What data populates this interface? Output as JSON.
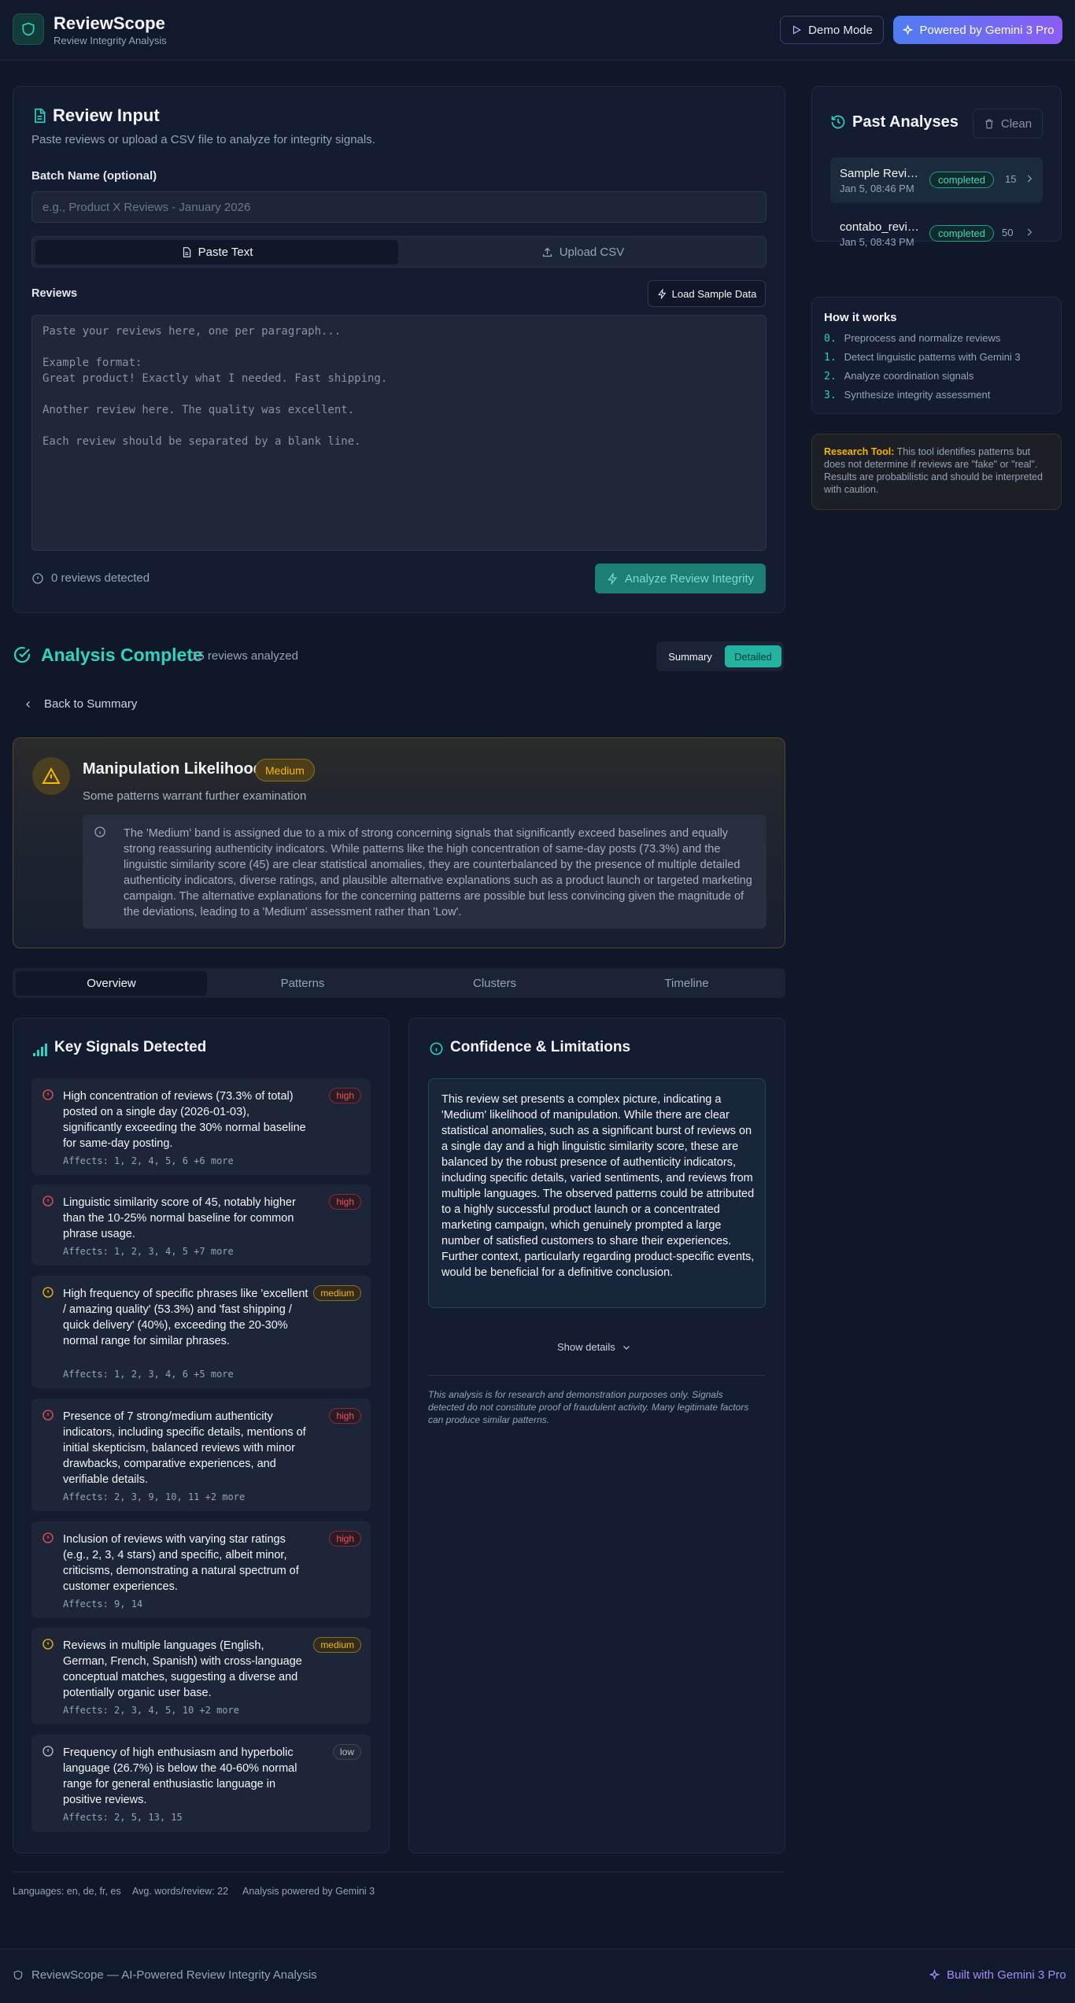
{
  "header": {
    "brand_title": "ReviewScope",
    "brand_subtitle": "Review Integrity Analysis",
    "demo_label": "Demo Mode",
    "gemini_label": "Powered by Gemini 3 Pro"
  },
  "review_input": {
    "title": "Review Input",
    "subtitle": "Paste reviews or upload a CSV file to analyze for integrity signals.",
    "batch_label": "Batch Name (optional)",
    "batch_placeholder": "e.g., Product X Reviews - January 2026",
    "tab_paste": "Paste Text",
    "tab_csv": "Upload CSV",
    "reviews_label": "Reviews",
    "sample_label": "Load Sample Data",
    "reviews_placeholder": "Paste your reviews here, one per paragraph...\n\nExample format:\nGreat product! Exactly what I needed. Fast shipping.\n\nAnother review here. The quality was excellent.\n\nEach review should be separated by a blank line.",
    "detected_text": "0 reviews detected",
    "analyze_label": "Analyze Review Integrity"
  },
  "past_analyses": {
    "title": "Past Analyses",
    "clean_label": "Clean",
    "items": [
      {
        "name": "Sample Reviews",
        "date": "Jan 5, 08:46 PM",
        "status": "completed",
        "count": "15"
      },
      {
        "name": "contabo_reviews",
        "date": "Jan 5, 08:43 PM",
        "status": "completed",
        "count": "50"
      }
    ]
  },
  "how_it_works": {
    "title": "How it works",
    "steps": [
      {
        "n": "0.",
        "text": "Preprocess and normalize reviews"
      },
      {
        "n": "1.",
        "text": "Detect linguistic patterns with Gemini 3"
      },
      {
        "n": "2.",
        "text": "Analyze coordination signals"
      },
      {
        "n": "3.",
        "text": "Synthesize integrity assessment"
      }
    ]
  },
  "research": {
    "label": "Research Tool:",
    "text": " This tool identifies patterns but does not determine if reviews are \"fake\" or \"real\". Results are probabilistic and should be interpreted with caution."
  },
  "analysis": {
    "title": "Analysis Complete",
    "subtitle": "15 reviews analyzed",
    "summary_label": "Summary",
    "detailed_label": "Detailed",
    "back_label": "Back to Summary"
  },
  "manipulation": {
    "title": "Manipulation Likelihood",
    "badge": "Medium",
    "subtitle": "Some patterns warrant further examination",
    "note": "The 'Medium' band is assigned due to a mix of strong concerning signals that significantly exceed baselines and equally strong reassuring authenticity indicators. While patterns like the high concentration of same-day posts (73.3%) and the linguistic similarity score (45) are clear statistical anomalies, they are counterbalanced by the presence of multiple detailed authenticity indicators, diverse ratings, and plausible alternative explanations such as a product launch or targeted marketing campaign. The alternative explanations for the concerning patterns are possible but less convincing given the magnitude of the deviations, leading to a 'Medium' assessment rather than 'Low'."
  },
  "tabs": [
    "Overview",
    "Patterns",
    "Clusters",
    "Timeline"
  ],
  "signals": {
    "title": "Key Signals Detected",
    "items": [
      {
        "text": "High concentration of reviews (73.3% of total) posted on a single day (2026-01-03), significantly exceeding the 30% normal baseline for same-day posting.",
        "affects": "Affects: 1, 2, 4, 5, 6 +6 more",
        "severity": "high"
      },
      {
        "text": "Linguistic similarity score of 45, notably higher than the 10-25% normal baseline for common phrase usage.",
        "affects": "Affects: 1, 2, 3, 4, 5 +7 more",
        "severity": "high"
      },
      {
        "text": "High frequency of specific phrases like 'excellent / amazing quality' (53.3%) and 'fast shipping / quick delivery' (40%), exceeding the 20-30% normal range for similar phrases.",
        "affects": "Affects: 1, 2, 3, 4, 6 +5 more",
        "severity": "medium"
      },
      {
        "text": "Presence of 7 strong/medium authenticity indicators, including specific details, mentions of initial skepticism, balanced reviews with minor drawbacks, comparative experiences, and verifiable details.",
        "affects": "Affects: 2, 3, 9, 10, 11 +2 more",
        "severity": "high"
      },
      {
        "text": "Inclusion of reviews with varying star ratings (e.g., 2, 3, 4 stars) and specific, albeit minor, criticisms, demonstrating a natural spectrum of customer experiences.",
        "affects": "Affects: 9, 14",
        "severity": "high"
      },
      {
        "text": "Reviews in multiple languages (English, German, French, Spanish) with cross-language conceptual matches, suggesting a diverse and potentially organic user base.",
        "affects": "Affects: 2, 3, 4, 5, 10 +2 more",
        "severity": "medium"
      },
      {
        "text": "Frequency of high enthusiasm and hyperbolic language (26.7%) is below the 40-60% normal range for general enthusiastic language in positive reviews.",
        "affects": "Affects: 2, 5, 13, 15",
        "severity": "low"
      }
    ]
  },
  "confidence": {
    "title": "Confidence & Limitations",
    "text": "This review set presents a complex picture, indicating a 'Medium' likelihood of manipulation. While there are clear statistical anomalies, such as a significant burst of reviews on a single day and a high linguistic similarity score, these are balanced by the robust presence of authenticity indicators, including specific details, varied sentiments, and reviews from multiple languages. The observed patterns could be attributed to a highly successful product launch or a concentrated marketing campaign, which genuinely prompted a large number of satisfied customers to share their experiences. Further context, particularly regarding product-specific events, would be beneficial for a definitive conclusion.",
    "show_details": "Show details",
    "disclaimer": "This analysis is for research and demonstration purposes only. Signals detected do not constitute proof of fraudulent activity. Many legitimate factors can produce similar patterns."
  },
  "meta": {
    "languages": "Languages: en, de, fr, es",
    "avg_words": "Avg. words/review: 22",
    "powered": "Analysis powered by Gemini 3"
  },
  "footer": {
    "left": "ReviewScope — AI-Powered Review Integrity Analysis",
    "right": "Built with Gemini 3 Pro"
  },
  "colors": {
    "accent_teal": "#2dd4bf",
    "high": "#f0504f",
    "medium": "#f5b90c",
    "low": "#b8c0cc"
  }
}
